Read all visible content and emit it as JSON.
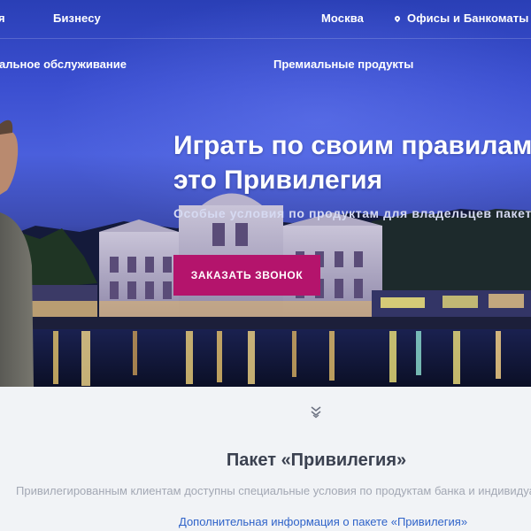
{
  "topnav": {
    "private_fragment": "я",
    "business": "Бизнесу",
    "city": "Москва",
    "offices": "Офисы и Банкоматы"
  },
  "subnav": {
    "service": "альное обслуживание",
    "premium": "Премиальные продукты"
  },
  "hero": {
    "headline_line1": "Играть по своим правилам —",
    "headline_line2": "это Привилегия",
    "subtitle": "Особые условия по продуктам для владельцев пакета",
    "cta": "ЗАКАЗАТЬ ЗВОНОК"
  },
  "package": {
    "title": "Пакет «Привилегия»",
    "description": "Привилегированным клиентам доступны специальные условия по продуктам банка и индивидуальн",
    "link": "Дополнительная информация о пакете «Привилегия»"
  },
  "icons": {
    "location": "map-pin-icon",
    "scroll": "double-chevron-down-icon"
  },
  "colors": {
    "cta": "#b4146c",
    "link": "#2f63c9",
    "sky": "#3b4fd0"
  }
}
